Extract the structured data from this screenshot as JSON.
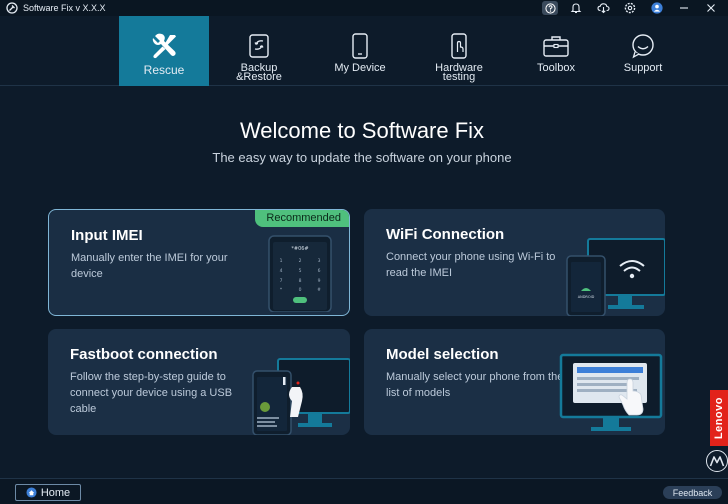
{
  "app": {
    "title": "Software Fix v X.X.X"
  },
  "titlebar": {
    "icons": [
      "help-icon",
      "bell-icon",
      "cloud-download-icon",
      "settings-icon",
      "user-icon",
      "minimize-icon",
      "close-icon"
    ]
  },
  "nav": {
    "tabs": [
      {
        "id": "rescue",
        "label": "Rescue",
        "icon": "wrench-screwdriver-icon",
        "active": true
      },
      {
        "id": "backup",
        "label": "Backup\n&Restore",
        "icon": "backup-restore-icon",
        "active": false
      },
      {
        "id": "device",
        "label": "My Device",
        "icon": "phone-icon",
        "active": false
      },
      {
        "id": "hardware",
        "label": "Hardware\ntesting",
        "icon": "phone-touch-icon",
        "active": false
      },
      {
        "id": "toolbox",
        "label": "Toolbox",
        "icon": "toolbox-icon",
        "active": false
      },
      {
        "id": "support",
        "label": "Support",
        "icon": "chat-bubble-icon",
        "active": false
      }
    ]
  },
  "welcome": {
    "title": "Welcome to Software Fix",
    "subtitle": "The easy way to update the software on your phone"
  },
  "cards": {
    "imei": {
      "title": "Input IMEI",
      "desc": "Manually enter the IMEI for your device",
      "badge": "Recommended",
      "dial_code": "*#06#"
    },
    "wifi": {
      "title": "WiFi Connection",
      "desc": "Connect your phone using Wi-Fi to read the IMEI",
      "android_label": "ANDROID"
    },
    "fastboot": {
      "title": "Fastboot connection",
      "desc": "Follow the step-by-step guide to connect your device using a USB cable"
    },
    "model": {
      "title": "Model selection",
      "desc": "Manually select your phone from the list of models"
    }
  },
  "footer": {
    "home_label": "Home",
    "feedback_label": "Feedback",
    "brand": "Lenovo"
  },
  "colors": {
    "accent": "#147a9a",
    "badge": "#4fc07d",
    "brand_red": "#e2231a",
    "card_bg": "#1b2f45",
    "page_bg": "#0d1b2a"
  }
}
